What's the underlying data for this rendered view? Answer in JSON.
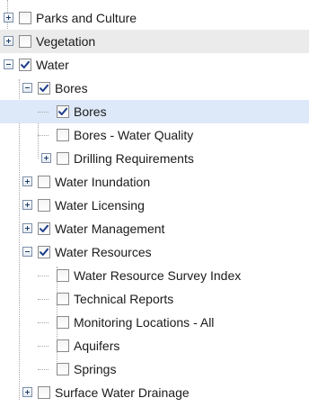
{
  "tree": {
    "rows": [
      {
        "label": "Parks and Culture",
        "checked": false,
        "expander": "collapsed",
        "level": 0
      },
      {
        "label": "Vegetation",
        "checked": false,
        "expander": "collapsed",
        "level": 0,
        "shaded": true
      },
      {
        "label": "Water",
        "checked": true,
        "expander": "expanded",
        "level": 0
      },
      {
        "label": "Bores",
        "checked": true,
        "expander": "expanded",
        "level": 1
      },
      {
        "label": "Bores",
        "checked": true,
        "expander": "none",
        "level": 2,
        "selected": true
      },
      {
        "label": "Bores - Water Quality",
        "checked": false,
        "expander": "none",
        "level": 2
      },
      {
        "label": "Drilling Requirements",
        "checked": false,
        "expander": "collapsed",
        "level": 2
      },
      {
        "label": "Water Inundation",
        "checked": false,
        "expander": "collapsed",
        "level": 1
      },
      {
        "label": "Water Licensing",
        "checked": false,
        "expander": "collapsed",
        "level": 1
      },
      {
        "label": "Water Management",
        "checked": true,
        "expander": "collapsed",
        "level": 1
      },
      {
        "label": "Water Resources",
        "checked": true,
        "expander": "expanded",
        "level": 1
      },
      {
        "label": "Water Resource Survey Index",
        "checked": false,
        "expander": "none",
        "level": 2
      },
      {
        "label": "Technical Reports",
        "checked": false,
        "expander": "none",
        "level": 2
      },
      {
        "label": "Monitoring Locations - All",
        "checked": false,
        "expander": "none",
        "level": 2
      },
      {
        "label": "Aquifers",
        "checked": false,
        "expander": "none",
        "level": 2
      },
      {
        "label": "Springs",
        "checked": false,
        "expander": "none",
        "level": 2
      },
      {
        "label": "Surface Water Drainage",
        "checked": false,
        "expander": "collapsed",
        "level": 1
      }
    ],
    "colors": {
      "selected_row": "#dde8f8",
      "shaded_row": "#ebebeb",
      "checkmark": "#1e3f8a",
      "connector": "#a8a8a8"
    }
  }
}
